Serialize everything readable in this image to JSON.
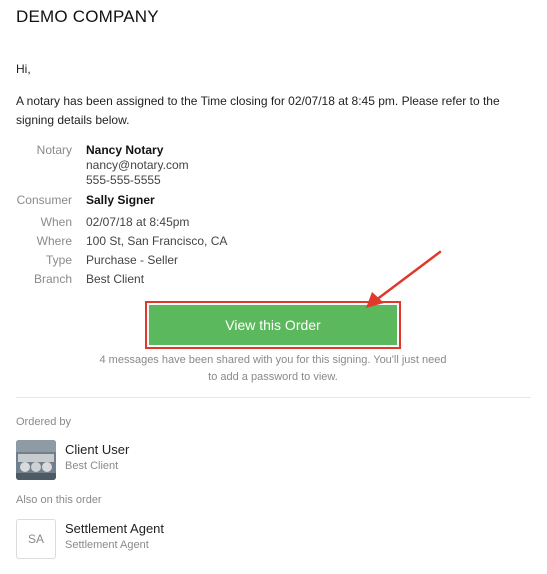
{
  "header": {
    "company": "DEMO COMPANY"
  },
  "email": {
    "greeting": "Hi,",
    "intro": "A notary has been assigned to the Time closing for 02/07/18 at 8:45 pm. Please refer to the signing details below."
  },
  "details": {
    "notary_label": "Notary",
    "notary_name": "Nancy Notary",
    "notary_email": "nancy@notary.com",
    "notary_phone": "555-555-5555",
    "consumer_label": "Consumer",
    "consumer_name": "Sally Signer",
    "when_label": "When",
    "when_value": "02/07/18 at 8:45pm",
    "where_label": "Where",
    "where_value": "100 St, San Francisco, CA",
    "type_label": "Type",
    "type_value": "Purchase - Seller",
    "branch_label": "Branch",
    "branch_value": "Best Client"
  },
  "cta": {
    "label": "View this Order",
    "message": "4 messages have been shared with you for this signing. You'll just need to add a password to view."
  },
  "ordered_by": {
    "label": "Ordered by",
    "name": "Client User",
    "company": "Best Client"
  },
  "also_on_order": {
    "label": "Also on this order",
    "initials": "SA",
    "name": "Settlement Agent",
    "role": "Settlement Agent"
  },
  "colors": {
    "button": "#5cb85c",
    "highlight": "#e0392b"
  }
}
